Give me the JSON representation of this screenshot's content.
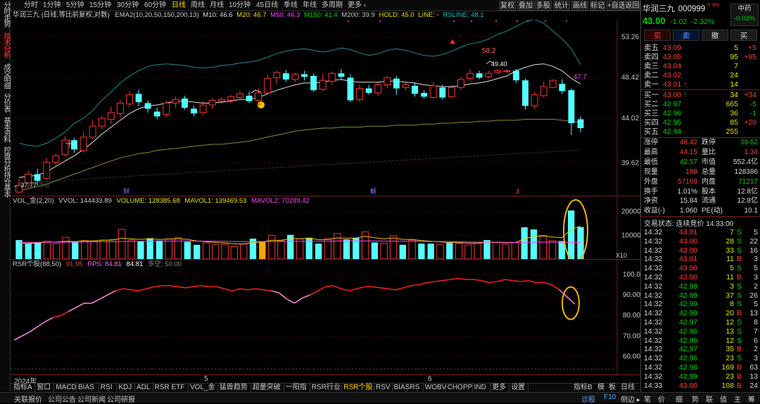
{
  "left_tabs": [
    "分时走势",
    "技术分析",
    "成交明细",
    "分价表",
    "基本资料",
    "控盘分析",
    "持仓基本"
  ],
  "periods": [
    "分时",
    "1分钟",
    "5分钟",
    "15分钟",
    "30分钟",
    "60分钟",
    "日线",
    "周线",
    "月线",
    "10分钟",
    "45日线",
    "季线",
    "年线",
    "多周期",
    "更多 ›"
  ],
  "active_period": "日线",
  "tools": [
    "复权",
    "叠加",
    "多股",
    "统计",
    "画线",
    "标记",
    "+自选",
    "返回"
  ],
  "main_legend": {
    "title": "华润三九 (日线,等比前复权,对数)",
    "indicator": "EMA2(10,20,50,150,200,13)",
    "m10": "M10: 46.6",
    "m20": "M20: 46.7",
    "m50": "M50: 46.3",
    "m150": "M150: 41.4",
    "m200": "M200: 39.9",
    "hold": "HOLD: 45.0",
    "line": "LINE: -",
    "rsline": "RSLINE: 48.1"
  },
  "price_axis": [
    "53.26",
    "48.42",
    "44.02",
    "39.62"
  ],
  "price_notes": {
    "high": "58.2",
    "peak": "49.40",
    "last": "47.7",
    "low": "37.77",
    "low_prefix": "← ",
    "marker": "财",
    "marker2": "解",
    "marker3": "3",
    "note": "数据"
  },
  "vol_legend": {
    "title": "VOL_金(2,20)",
    "vvol": "VVOL: 144433.89",
    "volume": "VOLUME: 128385.68",
    "mavol1": "MAVOL1: 139469.53",
    "mavol2": "MAVOL2: 70289.42"
  },
  "vol_axis": [
    "20000",
    "10000"
  ],
  "vol_unit": "X10",
  "rsr_legend": {
    "title": "RSR个股(88,50)",
    "v1": "91.95",
    "rps": "RPS: 84.81",
    "v3": "84.81",
    "dk": "多空: 50.00"
  },
  "rsr_axis": [
    "100.0",
    "90.00",
    "80.00",
    "70.00",
    "60.00"
  ],
  "date_axis": {
    "year": "2024年",
    "m5": "5",
    "m6": "6"
  },
  "bottom_tabs": [
    "指标A",
    "窗口",
    "MACD",
    "BIAS",
    "RSI",
    "KDJ",
    "ADL",
    "RSR ETF",
    "VOL_金",
    "猛兽趋势",
    "超量突破",
    "一阳指",
    "RSR行业",
    "RSR个股",
    "RSV",
    "BIASRS",
    "WOBV",
    "CHOPP",
    "IND",
    "更多",
    "设置"
  ],
  "active_bottom_tab": "RSR个股",
  "bottom_right": [
    "指标B",
    "模",
    "板",
    "日线"
  ],
  "status_left": [
    "关联报价",
    "公司公告",
    "公司新闻",
    "公司研报"
  ],
  "status_right": [
    "诊股",
    "F10",
    "侧边 ▸",
    "笔",
    "价",
    "细",
    "势",
    "联",
    "值",
    "主",
    "筹"
  ],
  "stock": {
    "name": "华润三九",
    "code": "000999",
    "tag": "R 300",
    "price": "43.00",
    "chg": "-1.02",
    "pct": "-2.32%",
    "sector": "中药",
    "sector_pct": "-0.03%"
  },
  "trade_buttons": [
    "买",
    "卖",
    "撤",
    "买"
  ],
  "asks": [
    {
      "label": "卖五",
      "price": "43.09",
      "vol": "5",
      "diff": "+5"
    },
    {
      "label": "卖四",
      "price": "43.05",
      "vol": "95",
      "diff": "+95"
    },
    {
      "label": "卖三",
      "price": "43.04",
      "vol": "7",
      "diff": ""
    },
    {
      "label": "卖二",
      "price": "43.02",
      "vol": "24",
      "diff": ""
    },
    {
      "label": "卖一",
      "price": "43.01 ↑",
      "vol": "14",
      "diff": ""
    }
  ],
  "bids": [
    {
      "label": "买一",
      "price": "43.00 ↑",
      "vol": "34",
      "diff": "+34"
    },
    {
      "label": "买二",
      "price": "42.97",
      "vol": "665",
      "diff": "-5"
    },
    {
      "label": "买三",
      "price": "42.96",
      "vol": "36",
      "diff": "-1"
    },
    {
      "label": "买四",
      "price": "42.95",
      "vol": "85",
      "diff": "+20"
    },
    {
      "label": "买五",
      "price": "42.94",
      "vol": "255",
      "diff": ""
    }
  ],
  "stats": [
    [
      {
        "k": "涨停",
        "v": "48.42",
        "c": "#ff3c3c"
      },
      {
        "k": "跌停",
        "v": "39.62",
        "c": "#00d200"
      }
    ],
    [
      {
        "k": "最高",
        "v": "44.15",
        "c": "#ff3c3c"
      },
      {
        "k": "量比",
        "v": "1.34",
        "c": "#ff3c3c"
      }
    ],
    [
      {
        "k": "最低",
        "v": "42.57",
        "c": "#00d200"
      },
      {
        "k": "市值",
        "v": "552.4亿",
        "c": "#d8d8d8"
      }
    ],
    [
      {
        "k": "现量",
        "v": "108",
        "c": "#ff3c3c"
      },
      {
        "k": "总量",
        "v": "128386",
        "c": "#d8d8d8"
      }
    ],
    [
      {
        "k": "外盘",
        "v": "57169",
        "c": "#ff3c3c"
      },
      {
        "k": "内盘",
        "v": "71217",
        "c": "#00d200"
      }
    ],
    [
      {
        "k": "换手",
        "v": "1.01%",
        "c": "#d8d8d8"
      },
      {
        "k": "股本",
        "v": "12.8亿",
        "c": "#d8d8d8"
      }
    ],
    [
      {
        "k": "净资",
        "v": "15.84",
        "c": "#d8d8d8"
      },
      {
        "k": "流通",
        "v": "12.8亿",
        "c": "#d8d8d8"
      }
    ],
    [
      {
        "k": "收益(-)",
        "v": "1.060",
        "c": "#d8d8d8"
      },
      {
        "k": "PE(动)",
        "v": "10.1",
        "c": "#d8d8d8"
      }
    ]
  ],
  "trade_status": "交易状态: 连续竞价 14:33:00",
  "ticks": [
    {
      "t": "14:32",
      "p": "43.01",
      "v": "7",
      "s": "S",
      "n": "5"
    },
    {
      "t": "14:32",
      "p": "43.00",
      "v": "28",
      "s": "S",
      "n": "22"
    },
    {
      "t": "14:32",
      "p": "43.00",
      "v": "33",
      "s": "S",
      "n": "16"
    },
    {
      "t": "14:32",
      "p": "43.01",
      "v": "11",
      "s": "B",
      "n": "3"
    },
    {
      "t": "14:32",
      "p": "43.00",
      "v": "5",
      "s": "S",
      "n": "5"
    },
    {
      "t": "14:32",
      "p": "43.00",
      "v": "11",
      "s": "B",
      "n": "3"
    },
    {
      "t": "14:32",
      "p": "42.99",
      "v": "3",
      "s": "S",
      "n": "2"
    },
    {
      "t": "14:32",
      "p": "42.99",
      "v": "37",
      "s": "S",
      "n": "26"
    },
    {
      "t": "14:32",
      "p": "42.99",
      "v": "8",
      "s": "S",
      "n": "5"
    },
    {
      "t": "14:32",
      "p": "42.99",
      "v": "20",
      "s": "B",
      "n": "13"
    },
    {
      "t": "14:32",
      "p": "42.97",
      "v": "12",
      "s": "S",
      "n": "8"
    },
    {
      "t": "14:32",
      "p": "42.96",
      "v": "13",
      "s": "S",
      "n": "7"
    },
    {
      "t": "14:32",
      "p": "42.96",
      "v": "12",
      "s": "S",
      "n": "6"
    },
    {
      "t": "14:32",
      "p": "42.97",
      "v": "35",
      "s": "B",
      "n": "2"
    },
    {
      "t": "14:32",
      "p": "42.96",
      "v": "23",
      "s": "S",
      "n": "3"
    },
    {
      "t": "14:32",
      "p": "42.98",
      "v": "169",
      "s": "B",
      "n": "63"
    },
    {
      "t": "14:32",
      "p": "42.99",
      "v": "23",
      "s": "B",
      "n": "13"
    },
    {
      "t": "14:33",
      "p": "43.00",
      "v": "108",
      "s": "B",
      "n": "24"
    }
  ],
  "chart_data": {
    "type": "candlestick",
    "title": "华润三九 (日线,等比前复权,对数)",
    "price_ylim": [
      37.0,
      55.0
    ],
    "candles": [
      {
        "o": 37.0,
        "c": 37.6,
        "h": 38.2,
        "l": 36.9
      },
      {
        "o": 37.8,
        "c": 38.6,
        "h": 38.9,
        "l": 37.5
      },
      {
        "o": 38.6,
        "c": 38.0,
        "h": 39.1,
        "l": 37.6
      },
      {
        "o": 38.2,
        "c": 39.7,
        "h": 40.1,
        "l": 38.1
      },
      {
        "o": 39.7,
        "c": 40.3,
        "h": 40.5,
        "l": 39.3
      },
      {
        "o": 40.4,
        "c": 41.8,
        "h": 42.2,
        "l": 40.2
      },
      {
        "o": 41.8,
        "c": 40.9,
        "h": 42.0,
        "l": 40.6
      },
      {
        "o": 40.8,
        "c": 42.1,
        "h": 42.6,
        "l": 40.6
      },
      {
        "o": 42.1,
        "c": 43.2,
        "h": 43.8,
        "l": 41.9
      },
      {
        "o": 43.2,
        "c": 44.0,
        "h": 44.3,
        "l": 42.9
      },
      {
        "o": 43.9,
        "c": 44.6,
        "h": 45.2,
        "l": 43.4
      },
      {
        "o": 44.5,
        "c": 45.6,
        "h": 45.9,
        "l": 44.1
      },
      {
        "o": 45.5,
        "c": 46.5,
        "h": 46.9,
        "l": 45.2
      },
      {
        "o": 46.6,
        "c": 45.7,
        "h": 47.1,
        "l": 45.3
      },
      {
        "o": 45.6,
        "c": 45.0,
        "h": 45.9,
        "l": 44.6
      },
      {
        "o": 44.7,
        "c": 44.2,
        "h": 45.1,
        "l": 43.9
      },
      {
        "o": 44.4,
        "c": 45.6,
        "h": 45.9,
        "l": 44.1
      },
      {
        "o": 45.6,
        "c": 46.0,
        "h": 46.3,
        "l": 45.1
      },
      {
        "o": 46.1,
        "c": 45.1,
        "h": 46.4,
        "l": 44.9
      },
      {
        "o": 45.0,
        "c": 44.5,
        "h": 45.3,
        "l": 44.2
      },
      {
        "o": 44.6,
        "c": 45.4,
        "h": 45.8,
        "l": 44.3
      },
      {
        "o": 45.4,
        "c": 45.9,
        "h": 46.1,
        "l": 45.0
      },
      {
        "o": 45.8,
        "c": 46.0,
        "h": 46.2,
        "l": 45.5
      },
      {
        "o": 45.9,
        "c": 46.3,
        "h": 46.5,
        "l": 45.6
      },
      {
        "o": 46.2,
        "c": 46.6,
        "h": 46.9,
        "l": 45.9
      },
      {
        "o": 46.4,
        "c": 45.8,
        "h": 46.8,
        "l": 45.6
      },
      {
        "o": 45.9,
        "c": 46.7,
        "h": 47.2,
        "l": 45.6
      },
      {
        "o": 46.7,
        "c": 48.3,
        "h": 48.8,
        "l": 46.5
      },
      {
        "o": 48.4,
        "c": 49.0,
        "h": 49.2,
        "l": 47.7
      },
      {
        "o": 48.9,
        "c": 48.2,
        "h": 49.3,
        "l": 47.9
      },
      {
        "o": 48.2,
        "c": 48.8,
        "h": 49.0,
        "l": 47.9
      },
      {
        "o": 48.8,
        "c": 48.5,
        "h": 49.2,
        "l": 48.1
      },
      {
        "o": 48.6,
        "c": 47.0,
        "h": 48.9,
        "l": 46.8
      },
      {
        "o": 47.1,
        "c": 48.1,
        "h": 48.8,
        "l": 46.9
      },
      {
        "o": 48.0,
        "c": 48.9,
        "h": 49.1,
        "l": 47.6
      },
      {
        "o": 48.9,
        "c": 48.5,
        "h": 49.4,
        "l": 48.2
      },
      {
        "o": 48.4,
        "c": 45.9,
        "h": 48.8,
        "l": 45.7
      },
      {
        "o": 46.0,
        "c": 47.2,
        "h": 47.6,
        "l": 45.7
      },
      {
        "o": 47.2,
        "c": 46.7,
        "h": 47.6,
        "l": 46.5
      },
      {
        "o": 46.7,
        "c": 47.6,
        "h": 47.9,
        "l": 46.4
      },
      {
        "o": 47.6,
        "c": 48.4,
        "h": 48.6,
        "l": 47.2
      },
      {
        "o": 48.3,
        "c": 47.2,
        "h": 48.6,
        "l": 46.5
      },
      {
        "o": 47.3,
        "c": 47.6,
        "h": 47.9,
        "l": 47.0
      },
      {
        "o": 47.5,
        "c": 46.6,
        "h": 47.8,
        "l": 46.3
      },
      {
        "o": 46.7,
        "c": 46.3,
        "h": 47.0,
        "l": 46.1
      },
      {
        "o": 46.2,
        "c": 47.5,
        "h": 47.9,
        "l": 46.1
      },
      {
        "o": 47.3,
        "c": 46.2,
        "h": 47.6,
        "l": 46.0
      },
      {
        "o": 46.3,
        "c": 47.3,
        "h": 47.6,
        "l": 46.1
      },
      {
        "o": 47.3,
        "c": 48.2,
        "h": 48.5,
        "l": 47.0
      },
      {
        "o": 48.3,
        "c": 48.9,
        "h": 49.4,
        "l": 48.0
      },
      {
        "o": 48.9,
        "c": 48.4,
        "h": 49.2,
        "l": 48.2
      },
      {
        "o": 48.5,
        "c": 48.9,
        "h": 49.2,
        "l": 48.3
      },
      {
        "o": 49.0,
        "c": 49.2,
        "h": 49.4,
        "l": 48.8
      },
      {
        "o": 49.1,
        "c": 49.2,
        "h": 49.4,
        "l": 48.9
      },
      {
        "o": 49.2,
        "c": 48.1,
        "h": 49.4,
        "l": 47.8
      },
      {
        "o": 48.1,
        "c": 45.3,
        "h": 48.3,
        "l": 44.9
      },
      {
        "o": 45.3,
        "c": 46.5,
        "h": 46.8,
        "l": 45.0
      },
      {
        "o": 46.4,
        "c": 47.4,
        "h": 48.0,
        "l": 46.2
      },
      {
        "o": 47.3,
        "c": 48.1,
        "h": 48.2,
        "l": 47.4
      },
      {
        "o": 47.7,
        "c": 46.9,
        "h": 48.2,
        "l": 46.6
      },
      {
        "o": 47.0,
        "c": 43.5,
        "h": 47.2,
        "l": 42.3
      },
      {
        "o": 43.9,
        "c": 43.0,
        "h": 44.2,
        "l": 42.6
      }
    ],
    "ma_fast": [
      38.3,
      38.4,
      38.5,
      38.8,
      39.3,
      39.8,
      40.3,
      40.9,
      41.6,
      42.4,
      43.1,
      43.8,
      44.5,
      45.0,
      45.3,
      45.4,
      45.6,
      45.8,
      45.8,
      45.7,
      45.6,
      45.6,
      45.7,
      45.8,
      46.0,
      46.0,
      46.2,
      46.6,
      47.0,
      47.3,
      47.6,
      47.8,
      47.8,
      47.9,
      48.1,
      48.2,
      48.0,
      47.9,
      47.9,
      47.9,
      48.0,
      48.0,
      47.9,
      47.8,
      47.6,
      47.5,
      47.4,
      47.4,
      47.5,
      47.7,
      47.8,
      48.0,
      48.3,
      48.6,
      49.2,
      49.6,
      49.9,
      50.0,
      49.7,
      49.2,
      48.3,
      47.7
    ],
    "ma_slow": [
      37.2,
      37.3,
      37.5,
      37.7,
      38.0,
      38.3,
      38.6,
      38.9,
      39.2,
      39.5,
      39.8,
      40.1,
      40.3,
      40.5,
      40.6,
      40.8,
      40.9,
      41.0,
      41.1,
      41.2,
      41.3,
      41.4,
      41.4,
      41.5,
      41.6,
      41.7,
      41.9,
      42.1,
      42.3,
      42.5,
      42.7,
      42.8,
      42.9,
      43.0,
      43.0,
      43.1,
      43.1,
      43.1,
      43.2,
      43.2,
      43.2,
      43.3,
      43.3,
      43.3,
      43.4,
      43.4,
      43.5,
      43.5,
      43.6,
      43.6,
      43.7,
      43.7,
      43.8,
      43.8,
      43.8,
      43.9,
      43.9,
      43.9,
      43.9,
      43.8,
      43.7,
      43.6
    ],
    "band_upper": [
      41.5,
      41.3,
      41.2,
      41.5,
      42.0,
      42.6,
      43.5,
      44.0,
      44.8,
      45.9,
      46.8,
      47.8,
      48.6,
      49.2,
      49.7,
      49.9,
      50.0,
      49.9,
      49.8,
      49.6,
      49.5,
      49.6,
      49.8,
      49.9,
      50.1,
      50.2,
      50.4,
      50.8,
      51.2,
      51.5,
      51.7,
      51.8,
      51.6,
      51.4,
      51.6,
      51.9,
      51.7,
      51.3,
      51.0,
      51.2,
      51.6,
      51.8,
      51.6,
      51.3,
      51.0,
      50.9,
      51.1,
      51.5,
      52.0,
      52.4,
      52.6,
      53.0,
      53.6,
      54.0,
      54.6,
      55.2,
      55.5,
      55.0,
      54.0,
      53.0,
      51.8,
      49.9
    ],
    "baseline": [
      37.8,
      37.85,
      37.9,
      37.95,
      38.0,
      38.05,
      38.1,
      38.15,
      38.2,
      38.25,
      38.3,
      38.35,
      38.4,
      38.45,
      38.5,
      38.55,
      38.6,
      38.65,
      38.7,
      38.75,
      38.8,
      38.85,
      38.9,
      38.95,
      39.0,
      39.05,
      39.1,
      39.15,
      39.2,
      39.25,
      39.3,
      39.35,
      39.4,
      39.45,
      39.5,
      39.55,
      39.6,
      39.65,
      39.7,
      39.75,
      39.8,
      39.85,
      39.9,
      39.95,
      40.0,
      40.05,
      40.1,
      40.15,
      40.2,
      40.25,
      40.3,
      40.35,
      40.4,
      40.45,
      40.5,
      40.55,
      40.6,
      40.65,
      40.7,
      40.75,
      40.8,
      40.85
    ],
    "volume_ylim": [
      0,
      22000
    ],
    "volume": [
      8000,
      6500,
      7000,
      7500,
      6500,
      9200,
      7000,
      7800,
      7600,
      8000,
      8200,
      12500,
      8000,
      7600,
      8800,
      7800,
      8500,
      9000,
      7300,
      6000,
      6800,
      6000,
      6200,
      5200,
      6300,
      8600,
      7500,
      10000,
      7700,
      10200,
      8500,
      9000,
      6500,
      8500,
      10800,
      8300,
      9000,
      11500,
      7000,
      6500,
      9800,
      6000,
      8000,
      6500,
      6500,
      6200,
      6800,
      6500,
      6000,
      6700,
      8000,
      7000,
      6300,
      7000,
      13400,
      12500,
      10000,
      7700,
      7600,
      20500,
      13500
    ],
    "volume_up": [
      0,
      0,
      0,
      1,
      1,
      1,
      0,
      1,
      1,
      1,
      1,
      1,
      1,
      0,
      0,
      0,
      1,
      1,
      0,
      0,
      1,
      1,
      1,
      1,
      1,
      0,
      1,
      1,
      1,
      0,
      1,
      0,
      0,
      1,
      1,
      0,
      0,
      1,
      0,
      1,
      1,
      0,
      1,
      0,
      0,
      1,
      0,
      1,
      1,
      1,
      0,
      1,
      1,
      1,
      0,
      0,
      1,
      1,
      0,
      0,
      0
    ],
    "volume_highlight": 26,
    "mavol1": [
      6500,
      6600,
      6800,
      7100,
      7200,
      7500,
      7400,
      7600,
      7700,
      7900,
      8000,
      8800,
      8500,
      8300,
      8500,
      8300,
      8400,
      8600,
      8300,
      7600,
      7300,
      7000,
      6800,
      6400,
      6400,
      7000,
      7200,
      7900,
      7900,
      8600,
      8600,
      8800,
      8200,
      8300,
      8900,
      8800,
      8900,
      9600,
      9000,
      8500,
      8900,
      8300,
      8300,
      7800,
      7500,
      7200,
      7000,
      6900,
      6700,
      6700,
      7100,
      7000,
      6900,
      6900,
      8500,
      9500,
      9700,
      9300,
      9000,
      12500,
      13900
    ],
    "mavol2": [
      7000,
      7000,
      7050,
      7100,
      7100,
      7150,
      7150,
      7200,
      7250,
      7300,
      7300,
      7400,
      7400,
      7450,
      7500,
      7500,
      7550,
      7600,
      7600,
      7550,
      7550,
      7500,
      7450,
      7400,
      7350,
      7350,
      7350,
      7400,
      7400,
      7450,
      7450,
      7500,
      7500,
      7550,
      7600,
      7600,
      7600,
      7650,
      7600,
      7550,
      7550,
      7500,
      7500,
      7450,
      7400,
      7350,
      7300,
      7250,
      7200,
      7150,
      7100,
      7100,
      7050,
      7000,
      7050,
      7100,
      7150,
      7150,
      7150,
      7000,
      7030
    ],
    "rsr_ylim": [
      52,
      102
    ],
    "rsr": [
      68.0,
      70.0,
      72.0,
      74.5,
      77.0,
      79.0,
      80.0,
      82.0,
      84.0,
      86.0,
      86.0,
      88.0,
      90.0,
      92.0,
      93.0,
      92.5,
      92.0,
      93.0,
      94.0,
      94.5,
      94.5,
      94.0,
      93.5,
      94.0,
      94.5,
      94.0,
      94.0,
      93.0,
      92.0,
      93.0,
      92.5,
      93.0,
      92.5,
      92.0,
      91.0,
      88.0,
      86.0,
      88.5,
      90.0,
      92.0,
      94.0,
      94.5,
      93.0,
      92.0,
      93.0,
      94.0,
      94.0,
      93.5,
      93.0,
      92.5,
      93.5,
      94.5,
      95.0,
      96.0,
      96.5,
      97.0,
      97.5,
      98.0,
      97.5,
      97.5,
      97.0,
      96.0,
      96.5,
      97.5,
      97.0,
      96.5,
      97.0,
      96.0,
      96.0,
      95.0,
      92.5,
      89.0,
      85.5
    ],
    "rsr_pink": [
      [
        0,
        5
      ],
      [
        7,
        13
      ],
      [
        33,
        38
      ],
      [
        70,
        72
      ]
    ]
  }
}
